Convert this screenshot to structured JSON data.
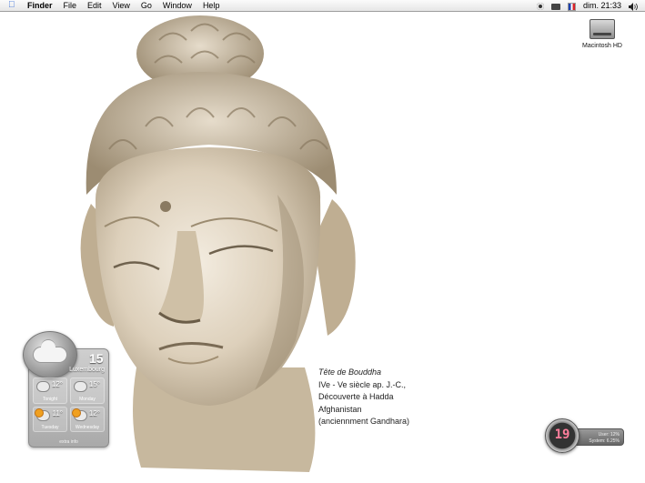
{
  "menubar": {
    "apple_icon": "apple-icon",
    "app_name": "Finder",
    "menus": [
      "File",
      "Edit",
      "View",
      "Go",
      "Window",
      "Help"
    ],
    "status_icons": [
      "gear-icon",
      "screen-icon",
      "flag-icon",
      "volume-icon"
    ],
    "clock": "dim. 21:33"
  },
  "desktop": {
    "hd_label": "Macintosh HD"
  },
  "caption": {
    "title": "Tête de Bouddha",
    "lines": [
      "IVe - Ve siècle ap. J.-C.,",
      "Découverte à Hadda",
      "Afghanistan",
      "(anciennment Gandhara)"
    ]
  },
  "weather": {
    "current_temp": "15",
    "city": "Luxembourg",
    "forecast": [
      {
        "temp": "12°",
        "day": "Tonight",
        "icon": "cloud-icon"
      },
      {
        "temp": "15°",
        "day": "Monday",
        "icon": "cloud-icon"
      },
      {
        "temp": "11°",
        "day": "Tuesday",
        "icon": "sun-cloud-icon"
      },
      {
        "temp": "12°",
        "day": "Wednesday",
        "icon": "sun-cloud-icon"
      }
    ],
    "footer": "extra info"
  },
  "cpu": {
    "value": "19",
    "user": "User: 12%",
    "system": "System: 6.25%"
  },
  "colors": {
    "menubar_bg": "#e9e9e9",
    "cpu_digits": "#ff7f9d",
    "apple_blue": "#3a6fd8"
  }
}
